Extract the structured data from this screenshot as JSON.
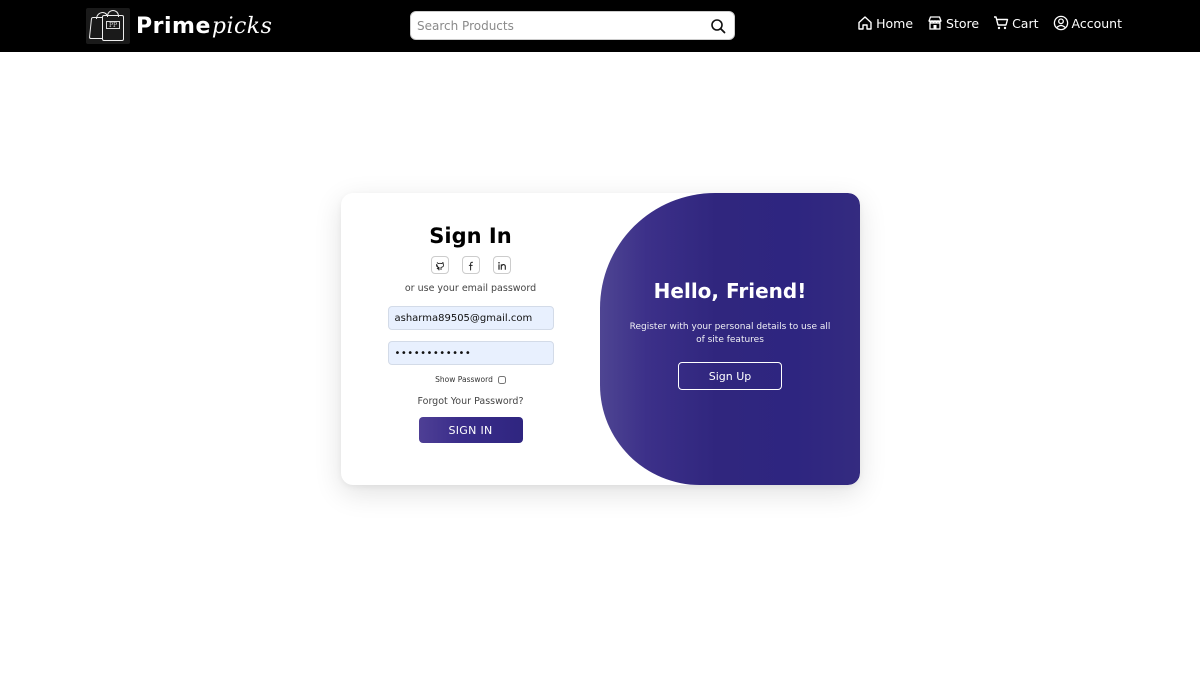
{
  "header": {
    "logo": {
      "text_bold": "Prime",
      "text_script": "picks",
      "badge": "PP"
    },
    "search": {
      "placeholder": "Search Products",
      "value": "",
      "icon": "search-icon"
    },
    "nav": [
      {
        "label": "Home",
        "icon": "home-icon"
      },
      {
        "label": "Store",
        "icon": "store-icon"
      },
      {
        "label": "Cart",
        "icon": "cart-icon"
      },
      {
        "label": "Account",
        "icon": "account-icon"
      }
    ]
  },
  "signin": {
    "title": "Sign In",
    "social": [
      {
        "name": "github",
        "icon": "github-icon"
      },
      {
        "name": "facebook",
        "icon": "facebook-icon"
      },
      {
        "name": "linkedin",
        "icon": "linkedin-icon"
      }
    ],
    "alt_text": "or use your email password",
    "email_value": "asharma89505@gmail.com",
    "password_value": "password1234",
    "show_password_label": "Show Password",
    "show_password_checked": false,
    "forgot_label": "Forgot Your Password?",
    "submit_label": "SIGN IN"
  },
  "toggle": {
    "title": "Hello, Friend!",
    "text": "Register with your personal details to use all of site features",
    "signup_label": "Sign Up"
  },
  "colors": {
    "navbar": "#000000",
    "accent": "#2f2580",
    "input_bg": "#e8f0fe"
  }
}
